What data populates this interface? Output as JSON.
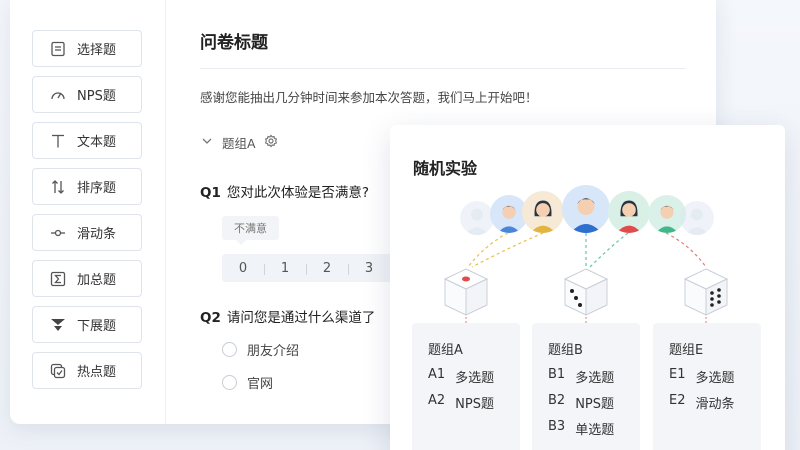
{
  "sidebar": {
    "items": [
      {
        "label": "选择题",
        "icon": "list-icon"
      },
      {
        "label": "NPS题",
        "icon": "gauge-icon"
      },
      {
        "label": "文本题",
        "icon": "text-t-icon"
      },
      {
        "label": "排序题",
        "icon": "sort-arrows-icon"
      },
      {
        "label": "滑动条",
        "icon": "slider-icon"
      },
      {
        "label": "加总题",
        "icon": "sigma-icon"
      },
      {
        "label": "下展题",
        "icon": "cascade-icon"
      },
      {
        "label": "热点题",
        "icon": "hotspot-icon"
      }
    ]
  },
  "form": {
    "title": "问卷标题",
    "intro": "感谢您能抽出几分钟时间来参加本次答题，我们马上开始吧！",
    "group_label": "题组A",
    "q1": {
      "num": "Q1",
      "text": "您对此次体验是否满意?",
      "tip": "不满意",
      "scale": [
        "0",
        "1",
        "2",
        "3"
      ]
    },
    "q2": {
      "num": "Q2",
      "text": "请问您是通过什么渠道了",
      "options": [
        "朋友介绍",
        "官网"
      ]
    }
  },
  "experiment": {
    "title": "随机实验",
    "groups": [
      {
        "name": "题组A",
        "rows": [
          {
            "code": "A1",
            "label": "多选题"
          },
          {
            "code": "A2",
            "label": "NPS题"
          }
        ]
      },
      {
        "name": "题组B",
        "rows": [
          {
            "code": "B1",
            "label": "多选题"
          },
          {
            "code": "B2",
            "label": "NPS题"
          },
          {
            "code": "B3",
            "label": "单选题"
          }
        ]
      },
      {
        "name": "题组E",
        "rows": [
          {
            "code": "E1",
            "label": "多选题"
          },
          {
            "code": "E2",
            "label": "滑动条"
          }
        ]
      }
    ]
  },
  "colors": {
    "accent_red": "#e14b4b",
    "dash_yellow": "#e8c14f",
    "dash_green": "#62c7a3",
    "dash_red": "#e87a7a"
  }
}
